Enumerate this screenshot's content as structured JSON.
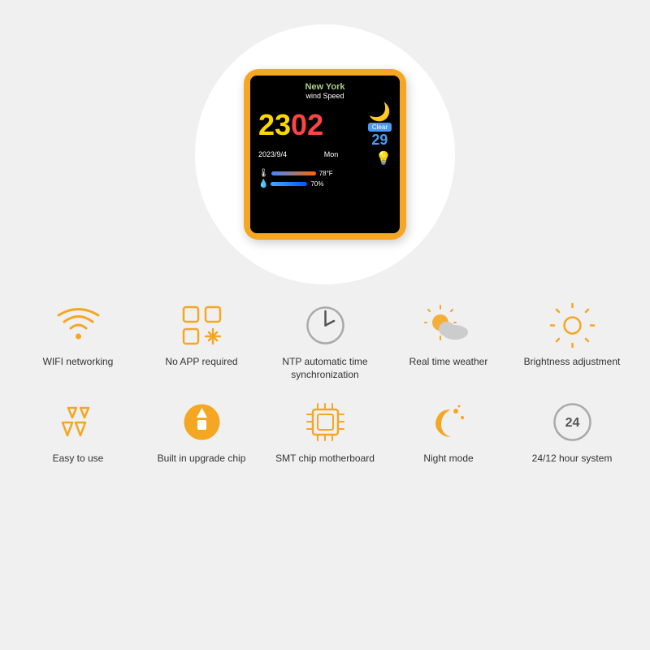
{
  "device": {
    "city": "New York",
    "wind_label": "wind Speed",
    "time": "2302",
    "time_colors": [
      "yellow",
      "red",
      "yellow",
      "red"
    ],
    "weather_clear": "Clear",
    "weather_temp": "29",
    "date": "2023/9/4",
    "day": "Mon",
    "temperature": "78°F",
    "humidity": "70%"
  },
  "features_row1": [
    {
      "id": "wifi",
      "label": "WIFI networking"
    },
    {
      "id": "apps",
      "label": "No APP required"
    },
    {
      "id": "ntp",
      "label": "NTP automatic time synchronization"
    },
    {
      "id": "weather",
      "label": "Real time weather"
    },
    {
      "id": "brightness",
      "label": "Brightness adjustment"
    }
  ],
  "features_row2": [
    {
      "id": "easy",
      "label": "Easy to use"
    },
    {
      "id": "chip",
      "label": "Built in upgrade chip"
    },
    {
      "id": "smt",
      "label": "SMT chip motherboard"
    },
    {
      "id": "night",
      "label": "Night mode"
    },
    {
      "id": "clock",
      "label": "24/12 hour system"
    }
  ]
}
